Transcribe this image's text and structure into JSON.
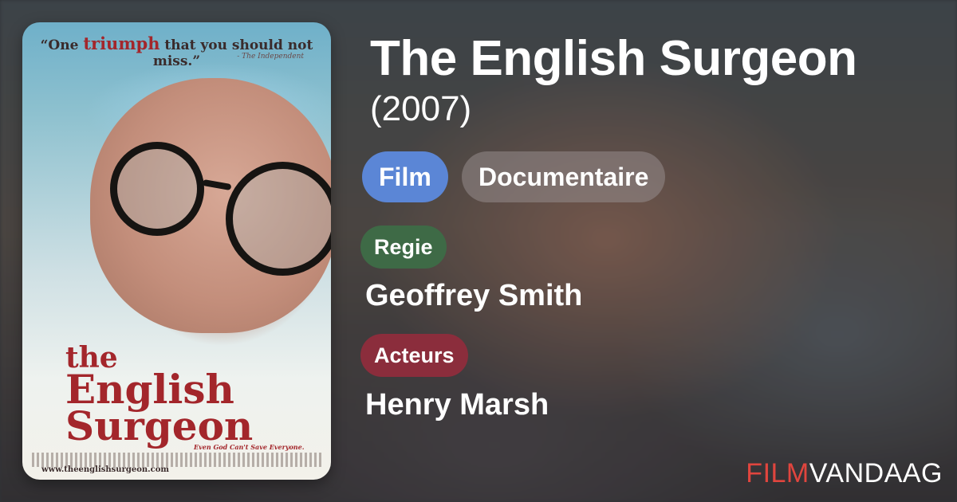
{
  "movie": {
    "title": "The English Surgeon",
    "year": "(2007)",
    "type": "Film",
    "genre": "Documentaire"
  },
  "sections": {
    "director_label": "Regie",
    "director": "Geoffrey Smith",
    "cast_label": "Acteurs",
    "cast": "Henry Marsh"
  },
  "poster": {
    "quote_pre": "“One ",
    "quote_em": "triumph",
    "quote_post": " that you should not miss.”",
    "quote_source": "- The Independent",
    "title_line1": "the",
    "title_line2": "English",
    "title_line3": "Surgeon",
    "tagline": "Even God Can't Save Everyone.",
    "url": "www.theenglishsurgeon.com"
  },
  "brand": {
    "part1": "FILM",
    "part2": "VANDAAG"
  },
  "colors": {
    "film_pill": "#5b86d6",
    "regie_pill": "#3e6a46",
    "acteurs_pill": "#8b2d3c",
    "brand_red": "#e0453e"
  }
}
